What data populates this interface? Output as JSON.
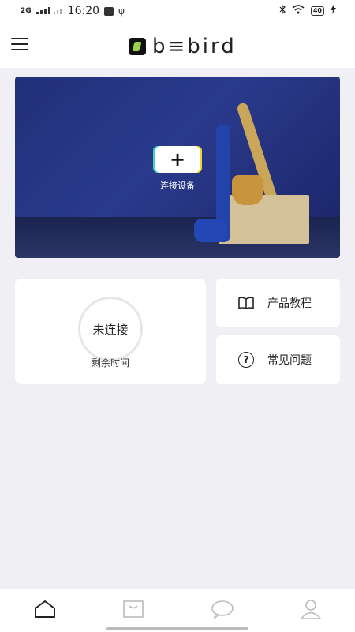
{
  "status_bar": {
    "network": "2G",
    "time": "16:20",
    "battery": "40"
  },
  "header": {
    "logo_text": "b≡bird"
  },
  "hero": {
    "connect_label": "连接设备",
    "plus_symbol": "+"
  },
  "device_card": {
    "status": "未连接",
    "remaining_label": "剩余时间"
  },
  "side_cards": {
    "tutorial_label": "产品教程",
    "faq_label": "常见问题",
    "faq_icon_glyph": "?"
  },
  "colors": {
    "accent_teal": "#37d6c6",
    "accent_yellow": "#f0d528",
    "logo_green": "#9cd34a"
  },
  "icons": [
    "menu-icon",
    "book-icon",
    "question-icon",
    "home-icon",
    "bag-icon",
    "chat-icon",
    "user-icon"
  ]
}
